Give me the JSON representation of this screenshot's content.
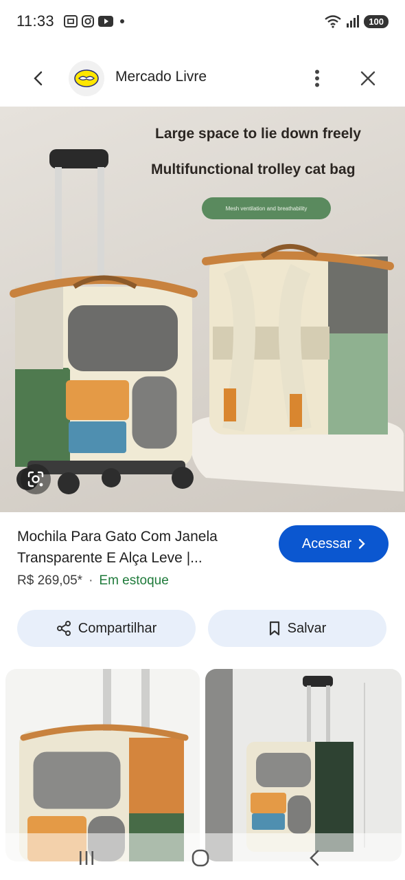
{
  "status_bar": {
    "time": "11:33",
    "battery": "100",
    "icons": [
      "screenshot-icon",
      "instagram-icon",
      "youtube-icon",
      "notification-dot",
      "wifi-icon",
      "signal-icon",
      "battery-icon"
    ]
  },
  "header": {
    "site_name": "Mercado Livre",
    "icons": [
      "back-arrow-icon",
      "mercado-livre-logo",
      "more-vert-icon",
      "close-icon"
    ]
  },
  "main_image": {
    "headline1": "Large space to lie down freely",
    "headline2": "Multifunctional trolley cat bag",
    "tag": "Mesh ventilation and breathability"
  },
  "product": {
    "title": "Mochila Para Gato Com Janela Transparente E Alça Leve |...",
    "price": "R$ 269,05*",
    "separator": "·",
    "stock": "Em estoque",
    "visit_label": "Acessar"
  },
  "actions": {
    "share_label": "Compartilhar",
    "save_label": "Salvar"
  },
  "colors": {
    "accent_blue": "#0b57d0",
    "stock_green": "#1e7a3a",
    "chip_bg": "#e8effa"
  },
  "nav": {
    "icons": [
      "recents-icon",
      "home-icon",
      "back-icon"
    ]
  }
}
